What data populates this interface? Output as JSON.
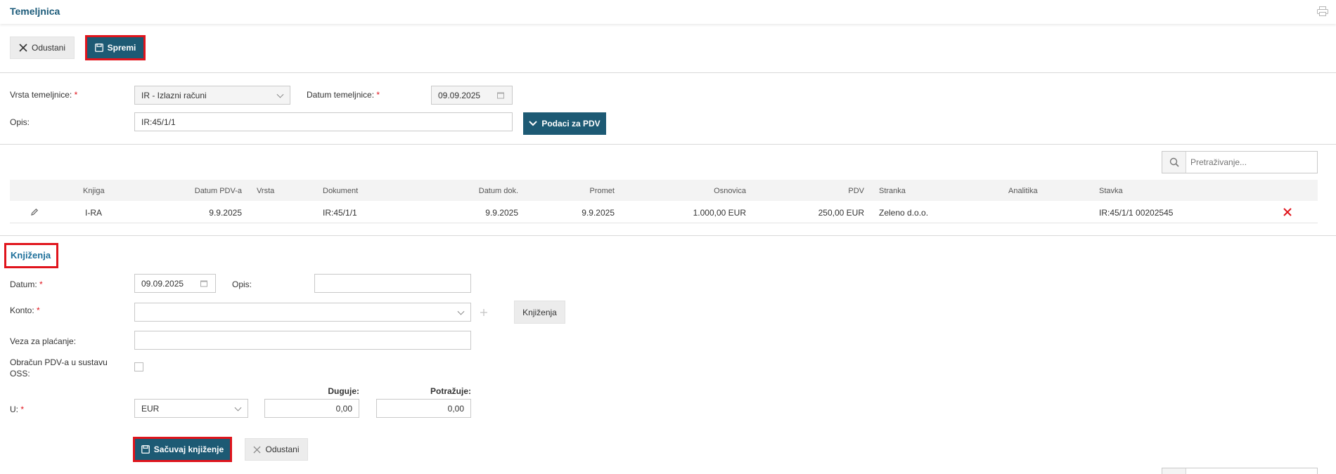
{
  "header": {
    "title": "Temeljnica"
  },
  "toolbar": {
    "cancel_label": "Odustani",
    "save_label": "Spremi"
  },
  "form": {
    "vrsta_label": "Vrsta temeljnice:",
    "vrsta_value": "IR - Izlazni računi",
    "datum_label": "Datum temeljnice:",
    "datum_value": "09.09.2025",
    "opis_label": "Opis:",
    "opis_value": "IR:45/1/1",
    "pdv_button": "Podaci za PDV"
  },
  "search": {
    "placeholder": "Pretraživanje..."
  },
  "table": {
    "headers": {
      "knjiga": "Knjiga",
      "datum_pdv": "Datum PDV-a",
      "vrsta": "Vrsta",
      "dokument": "Dokument",
      "datum_dok": "Datum dok.",
      "promet": "Promet",
      "osnovica": "Osnovica",
      "pdv": "PDV",
      "stranka": "Stranka",
      "analitika": "Analitika",
      "stavka": "Stavka"
    },
    "rows": [
      {
        "knjiga": "I-RA",
        "datum_pdv": "9.9.2025",
        "vrsta": "",
        "dokument": "IR:45/1/1",
        "datum_dok": "9.9.2025",
        "promet": "9.9.2025",
        "osnovica": "1.000,00 EUR",
        "pdv": "250,00 EUR",
        "stranka": "Zeleno d.o.o.",
        "analitika": "",
        "stavka": "IR:45/1/1 00202545"
      }
    ]
  },
  "knjizenja": {
    "title": "Knjiženja",
    "datum_label": "Datum:",
    "datum_value": "09.09.2025",
    "opis_label": "Opis:",
    "opis_value": "",
    "konto_label": "Konto:",
    "konto_value": "",
    "konto_button": "Knjiženja",
    "veza_label": "Veza za plaćanje:",
    "veza_value": "",
    "oss_label_1": "Obračun PDV-a u sustavu",
    "oss_label_2": "OSS:",
    "duguje_label": "Duguje:",
    "potrazuje_label": "Potražuje:",
    "u_label": "U:",
    "currency_value": "EUR",
    "duguje_value": "0,00",
    "potrazuje_value": "0,00",
    "save_button": "Sačuvaj knjiženje",
    "cancel_button": "Odustani"
  },
  "colors": {
    "accent": "#1d5a74",
    "title": "#1c5b7a",
    "highlight": "#e0141c"
  }
}
